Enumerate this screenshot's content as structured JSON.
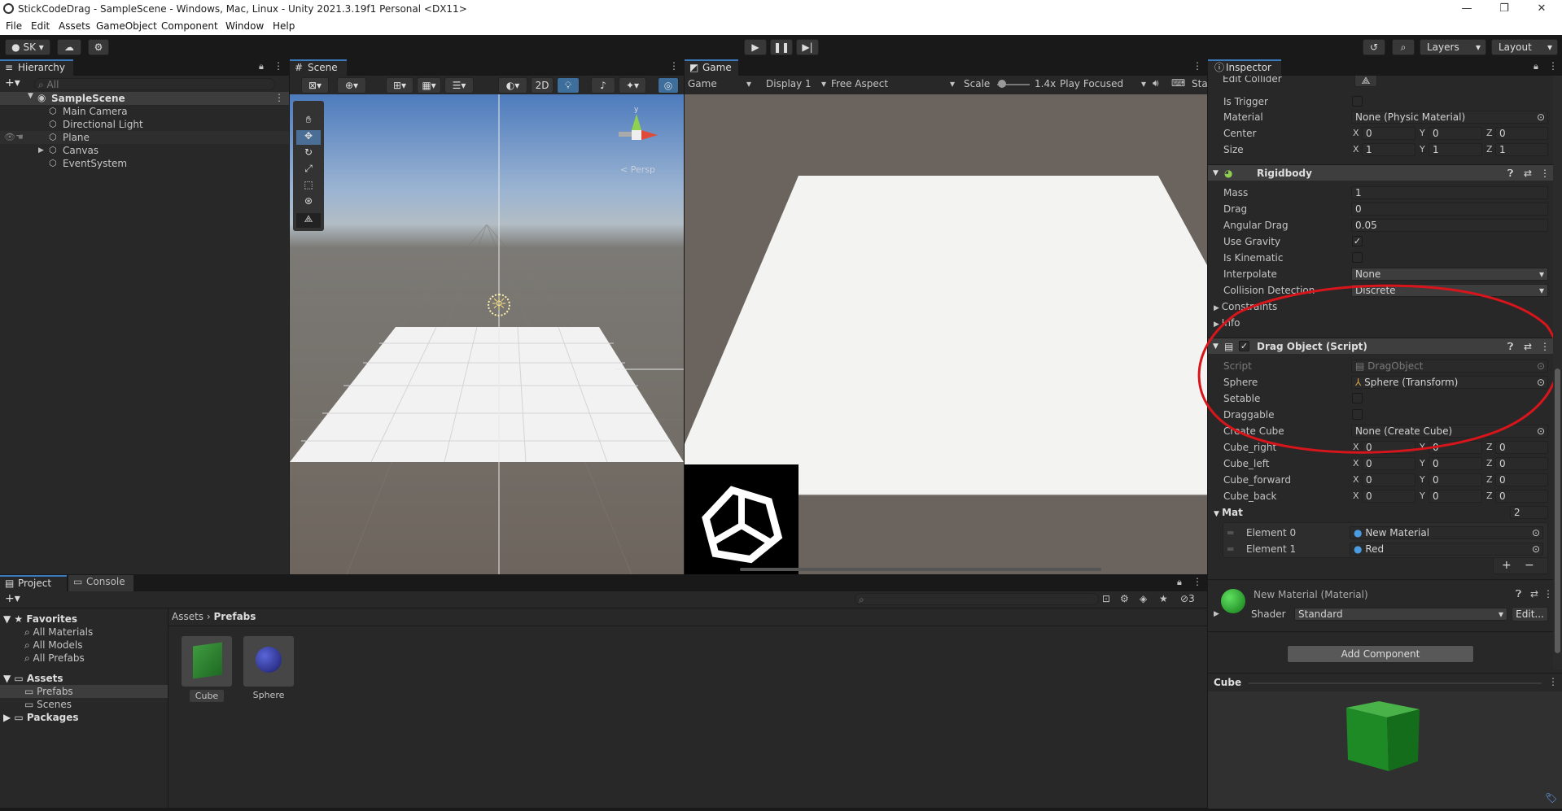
{
  "window": {
    "title": "StickCodeDrag - SampleScene - Windows, Mac, Linux - Unity 2021.3.19f1 Personal <DX11>",
    "min": "—",
    "max": "❐",
    "close": "✕"
  },
  "menu": [
    "File",
    "Edit",
    "Assets",
    "GameObject",
    "Component",
    "Window",
    "Help"
  ],
  "toolbar": {
    "account": "SK",
    "layers": "Layers",
    "layout": "Layout"
  },
  "hierarchy": {
    "tab": "Hierarchy",
    "search_placeholder": "All",
    "scene": "SampleScene",
    "items": [
      "Main Camera",
      "Directional Light",
      "Plane",
      "Canvas",
      "EventSystem"
    ]
  },
  "scene": {
    "tab": "Scene",
    "btn2d": "2D",
    "persp": "< Persp",
    "gizmo_y": "y"
  },
  "game": {
    "tab": "Game",
    "mode": "Game",
    "display": "Display 1",
    "aspect": "Free Aspect",
    "scale_label": "Scale",
    "scale_value": "1.4x",
    "play": "Play Focused",
    "stats": "Sta"
  },
  "project": {
    "tab": "Project",
    "console_tab": "Console",
    "favorites": "Favorites",
    "fav_items": [
      "All Materials",
      "All Models",
      "All Prefabs"
    ],
    "assets": "Assets",
    "asset_folders": [
      "Prefabs",
      "Scenes"
    ],
    "packages": "Packages",
    "breadcrumb_root": "Assets",
    "breadcrumb_current": "Prefabs",
    "hidden_count": "3",
    "prefabs": [
      "Cube",
      "Sphere"
    ]
  },
  "inspector": {
    "tab": "Inspector",
    "edit_collider": "Edit Collider",
    "is_trigger": "Is Trigger",
    "material_label": "Material",
    "material_value": "None (Physic Material)",
    "center_label": "Center",
    "center": [
      "0",
      "0",
      "0"
    ],
    "size_label": "Size",
    "size": [
      "1",
      "1",
      "1"
    ],
    "axis": [
      "X",
      "Y",
      "Z"
    ],
    "rigidbody": {
      "title": "Rigidbody",
      "mass_label": "Mass",
      "mass": "1",
      "drag_label": "Drag",
      "drag": "0",
      "angular_label": "Angular Drag",
      "angular": "0.05",
      "gravity_label": "Use Gravity",
      "kinematic_label": "Is Kinematic",
      "interp_label": "Interpolate",
      "interp": "None",
      "collision_label": "Collision Detection",
      "collision": "Discrete",
      "constraints": "Constraints",
      "info": "Info"
    },
    "script": {
      "title": "Drag Object (Script)",
      "script_label": "Script",
      "script_value": "DragObject",
      "sphere_label": "Sphere",
      "sphere_value": "Sphere (Transform)",
      "setable_label": "Setable",
      "draggable_label": "Draggable",
      "create_label": "Create Cube",
      "create_value": "None (Create Cube)",
      "vectors": [
        "Cube_right",
        "Cube_left",
        "Cube_forward",
        "Cube_back"
      ],
      "vec_value": "0",
      "mat_label": "Mat",
      "mat_count": "2",
      "elements": [
        {
          "label": "Element 0",
          "value": "New Material"
        },
        {
          "label": "Element 1",
          "value": "Red"
        }
      ]
    },
    "material": {
      "title": "New Material (Material)",
      "shader_label": "Shader",
      "shader": "Standard",
      "edit": "Edit..."
    },
    "add_component": "Add Component",
    "preview_title": "Cube"
  }
}
